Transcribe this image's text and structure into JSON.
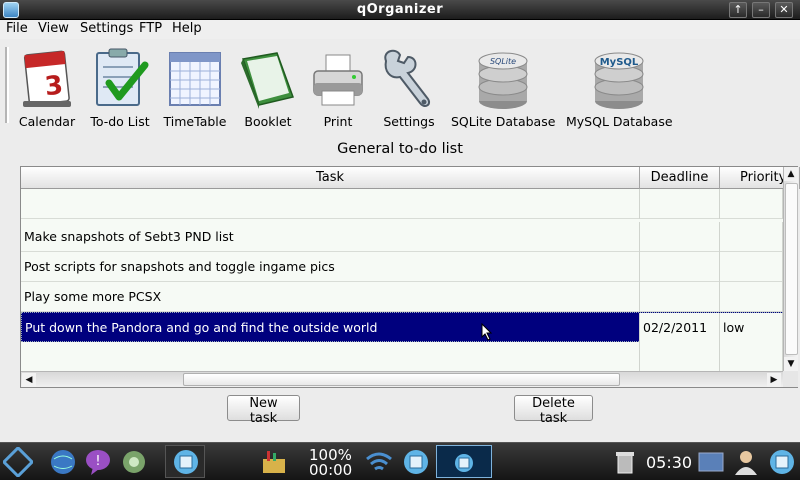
{
  "window": {
    "title": "qOrganizer"
  },
  "window_controls": {
    "up": "↑",
    "minimize": "–",
    "maximize": "□",
    "close": "✕"
  },
  "menu": [
    "File",
    "View",
    "Settings",
    "FTP",
    "Help"
  ],
  "toolbar": [
    {
      "label": "Calendar",
      "icon": "calendar-icon"
    },
    {
      "label": "To-do List",
      "icon": "todo-list-icon"
    },
    {
      "label": "TimeTable",
      "icon": "timetable-icon"
    },
    {
      "label": "Booklet",
      "icon": "booklet-icon"
    },
    {
      "label": "Print",
      "icon": "printer-icon"
    },
    {
      "label": "Settings",
      "icon": "wrench-icon"
    },
    {
      "label": "SQLite Database",
      "icon": "sqlite-database-icon",
      "badge": "SQLite"
    },
    {
      "label": "MySQL Database",
      "icon": "mysql-database-icon",
      "badge": "MySQL"
    }
  ],
  "calendar_icon_day": "3",
  "heading": "General to-do list",
  "table": {
    "columns": [
      "Task",
      "Deadline",
      "Priority"
    ],
    "rows": [
      {
        "task": "",
        "deadline": "",
        "priority": ""
      },
      {
        "task": "Make snapshots of Sebt3 PND list",
        "deadline": "",
        "priority": ""
      },
      {
        "task": "Post scripts for snapshots and toggle ingame pics",
        "deadline": "",
        "priority": ""
      },
      {
        "task": "Play some more PCSX",
        "deadline": "",
        "priority": ""
      },
      {
        "task": "Put down the Pandora and go and find the outside world",
        "deadline": "02/2/2011",
        "priority": "low",
        "selected": true
      },
      {
        "task": "",
        "deadline": "",
        "priority": ""
      }
    ]
  },
  "buttons": {
    "new_task": "New task",
    "delete_task": "Delete task"
  },
  "taskbar": {
    "volume": "100%",
    "timer": "00:00",
    "clock": "05:30"
  },
  "colors": {
    "selection": "#00007e",
    "taskbar": "#1c1c1c"
  }
}
